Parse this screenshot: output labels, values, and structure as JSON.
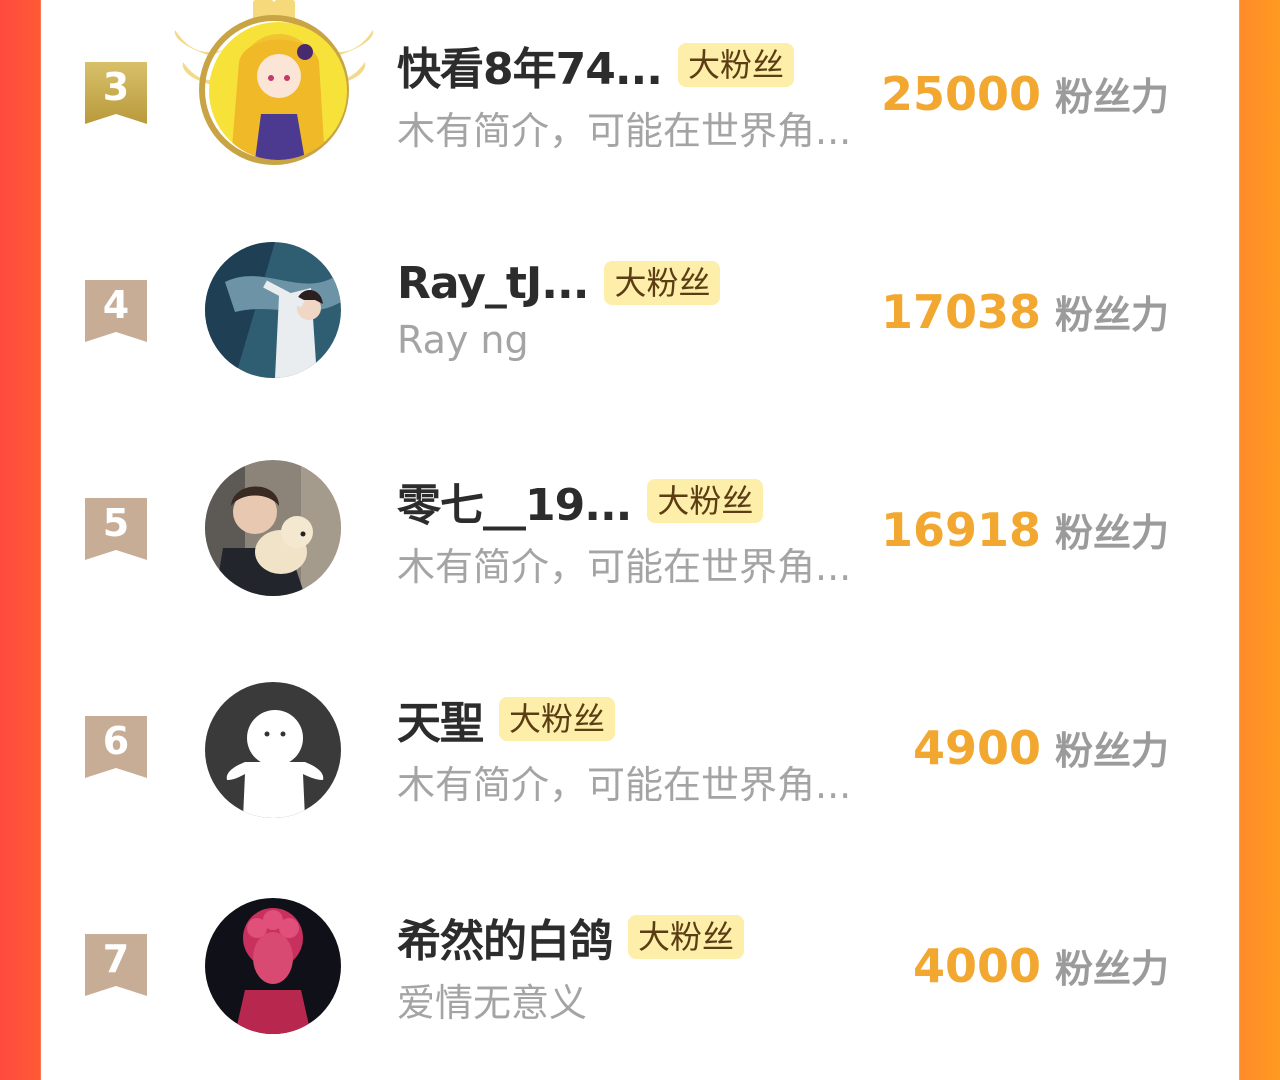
{
  "colors": {
    "accent": "#f2a830",
    "badge_bg": "#fdeeaa",
    "rank_gold": "#c9ae52",
    "rank_default": "#c8ad96",
    "frame_left": "#ff4a3f",
    "frame_right": "#ff9a22"
  },
  "ranking": [
    {
      "rank": "3",
      "name": "快看8年74...",
      "badge": "大粉丝",
      "bio": "木有简介，可能在世界角...",
      "score": "25000",
      "score_unit": "粉丝力",
      "avatar": "anime-girl-avatar",
      "frame": "crown-wings"
    },
    {
      "rank": "4",
      "name": "Ray_tJ...",
      "badge": "大粉丝",
      "bio": "Ray ng",
      "score": "17038",
      "score_unit": "粉丝力",
      "avatar": "manga-boy-avatar"
    },
    {
      "rank": "5",
      "name": "零七__19...",
      "badge": "大粉丝",
      "bio": "木有简介，可能在世界角...",
      "score": "16918",
      "score_unit": "粉丝力",
      "avatar": "boy-with-dog-avatar"
    },
    {
      "rank": "6",
      "name": "天聖",
      "badge": "大粉丝",
      "bio": "木有简介，可能在世界角...",
      "score": "4900",
      "score_unit": "粉丝力",
      "avatar": "default-ghost-avatar"
    },
    {
      "rank": "7",
      "name": "希然的白鸽",
      "badge": "大粉丝",
      "bio": "爱情无意义",
      "score": "4000",
      "score_unit": "粉丝力",
      "avatar": "statue-avatar"
    }
  ]
}
